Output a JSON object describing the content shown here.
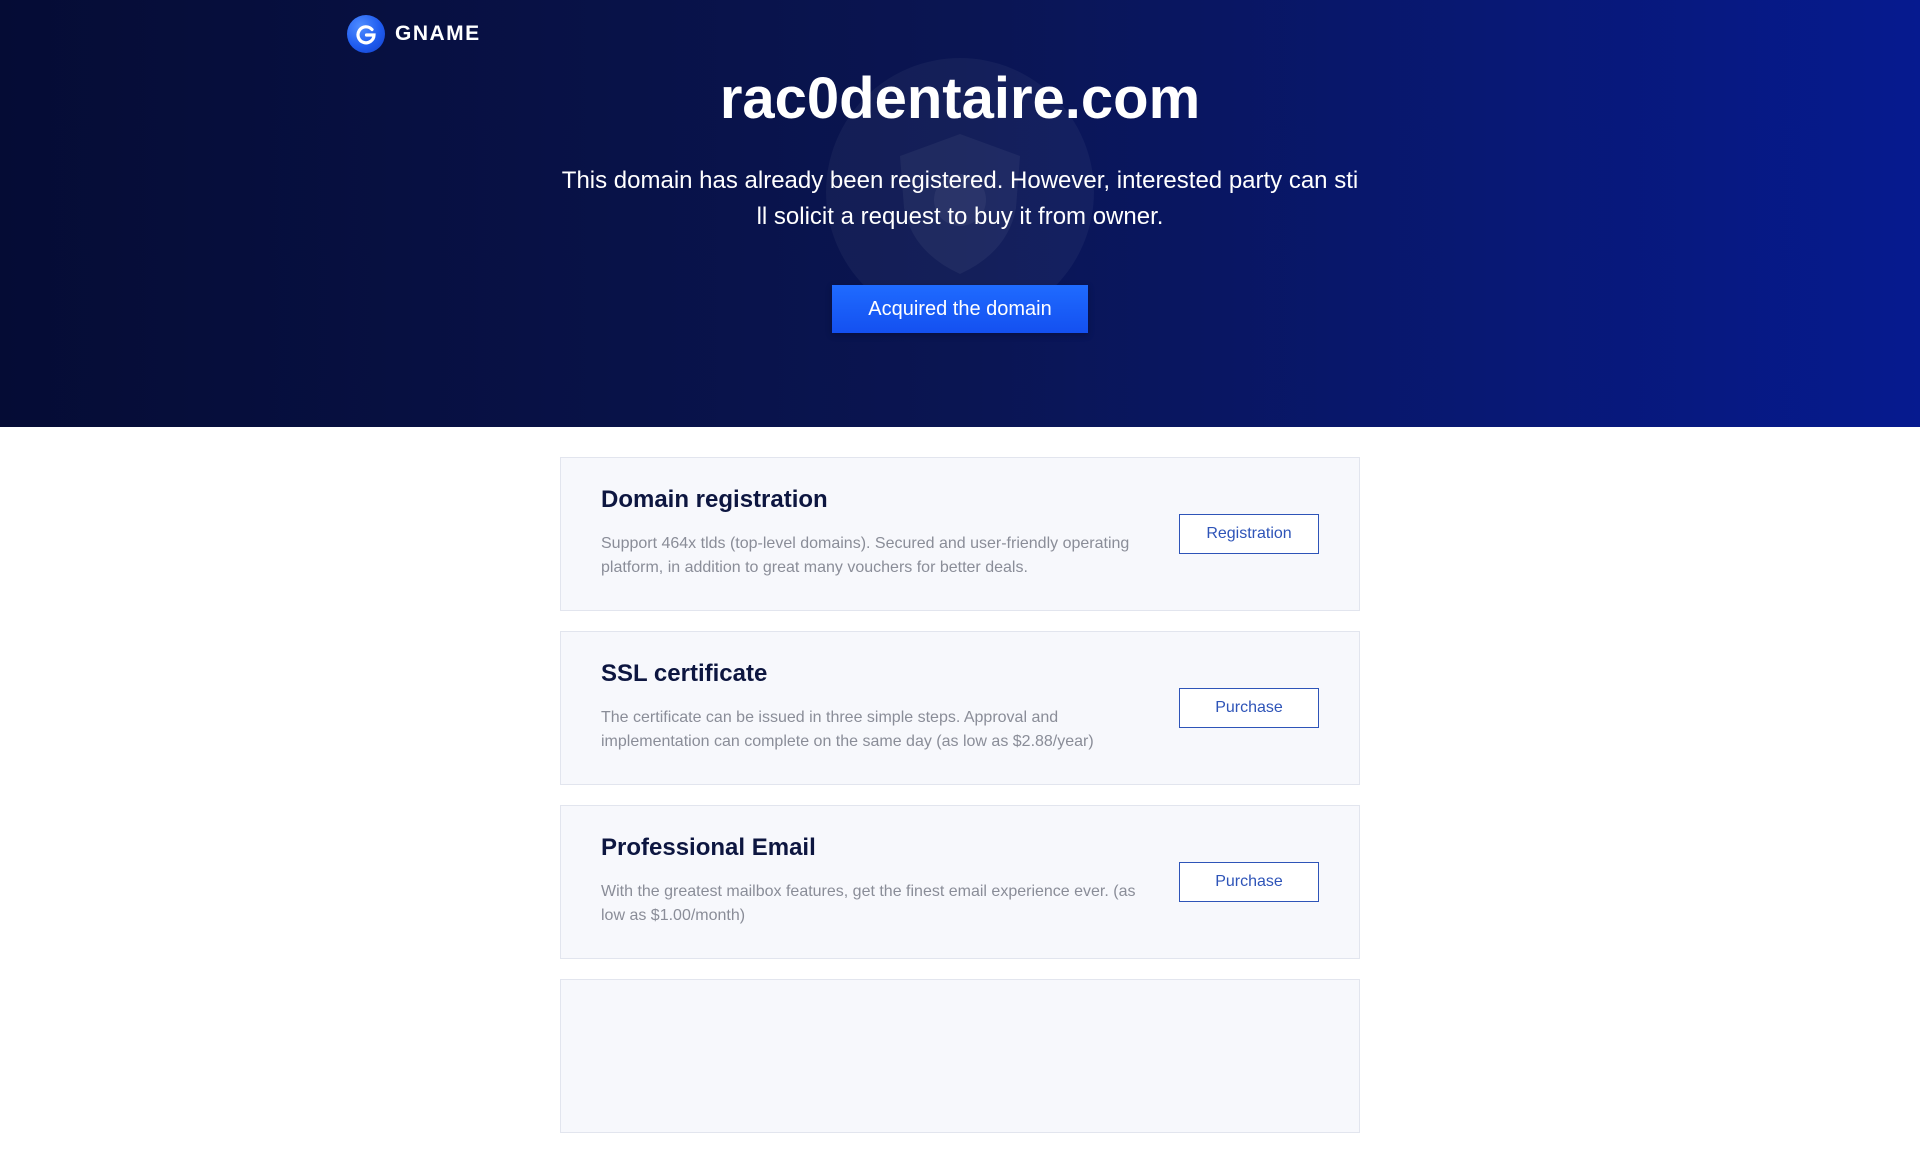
{
  "header": {
    "logo_text": "GNAME",
    "logo_icon": "gname-logo-icon"
  },
  "hero": {
    "domain": "rac0dentaire.com",
    "description": "This domain has already been registered. However, interested party can still solicit a request to buy it from owner.",
    "cta_label": "Acquired the domain"
  },
  "services": [
    {
      "title": "Domain registration",
      "description": "Support 464x tlds (top-level domains). Secured and user-friendly operating platform, in addition to great many vouchers for better deals.",
      "button": "Registration"
    },
    {
      "title": "SSL certificate",
      "description": "The certificate can be issued in three simple steps. Approval and implementation can complete on the same day (as low as $2.88/year)",
      "button": "Purchase"
    },
    {
      "title": "Professional Email",
      "description": "With the greatest mailbox features, get the finest email experience ever. (as low as $1.00/month)",
      "button": "Purchase"
    }
  ],
  "colors": {
    "hero_bg_start": "#050c35",
    "hero_bg_end": "#061a8f",
    "primary_button": "#1f6bff",
    "outline_button": "#2e54b8",
    "card_bg": "#f7f8fc"
  }
}
